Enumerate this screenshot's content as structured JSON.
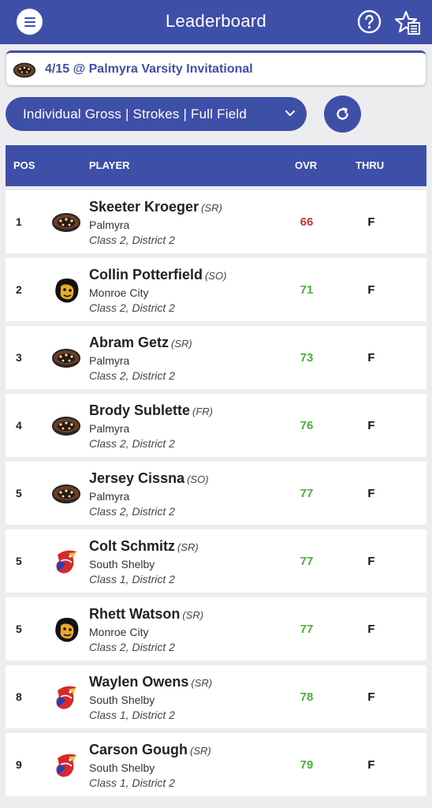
{
  "header": {
    "title": "Leaderboard"
  },
  "event": {
    "title": "4/15 @ Palmyra Varsity Invitational"
  },
  "view_select": {
    "label": "Individual Gross | Strokes | Full Field"
  },
  "table": {
    "columns": {
      "pos": "POS",
      "player": "PLAYER",
      "ovr": "OVR",
      "thru": "THRU"
    }
  },
  "colors": {
    "primary": "#3e4fa8",
    "score_under": "#c0392b",
    "score_over": "#4caf3a"
  },
  "rows": [
    {
      "pos": "1",
      "name": "Skeeter Kroeger",
      "year": "(SR)",
      "school": "Palmyra",
      "class": "Class 2, District 2",
      "score": "66",
      "thru": "F",
      "logo": "palmyra-logo-icon",
      "score_color": "#c0392b"
    },
    {
      "pos": "2",
      "name": "Collin Potterfield",
      "year": "(SO)",
      "school": "Monroe City",
      "class": "Class 2, District 2",
      "score": "71",
      "thru": "F",
      "logo": "monroe-city-logo-icon",
      "score_color": "#4caf3a"
    },
    {
      "pos": "3",
      "name": "Abram Getz",
      "year": "(SR)",
      "school": "Palmyra",
      "class": "Class 2, District 2",
      "score": "73",
      "thru": "F",
      "logo": "palmyra-logo-icon",
      "score_color": "#4caf3a"
    },
    {
      "pos": "4",
      "name": "Brody Sublette",
      "year": "(FR)",
      "school": "Palmyra",
      "class": "Class 2, District 2",
      "score": "76",
      "thru": "F",
      "logo": "palmyra-logo-icon",
      "score_color": "#4caf3a"
    },
    {
      "pos": "5",
      "name": "Jersey Cissna",
      "year": "(SO)",
      "school": "Palmyra",
      "class": "Class 2, District 2",
      "score": "77",
      "thru": "F",
      "logo": "palmyra-logo-icon",
      "score_color": "#4caf3a"
    },
    {
      "pos": "5",
      "name": "Colt Schmitz",
      "year": "(SR)",
      "school": "South Shelby",
      "class": "Class 1, District 2",
      "score": "77",
      "thru": "F",
      "logo": "south-shelby-logo-icon",
      "score_color": "#4caf3a"
    },
    {
      "pos": "5",
      "name": "Rhett Watson",
      "year": "(SR)",
      "school": "Monroe City",
      "class": "Class 2, District 2",
      "score": "77",
      "thru": "F",
      "logo": "monroe-city-logo-icon",
      "score_color": "#4caf3a"
    },
    {
      "pos": "8",
      "name": "Waylen Owens",
      "year": "(SR)",
      "school": "South Shelby",
      "class": "Class 1, District 2",
      "score": "78",
      "thru": "F",
      "logo": "south-shelby-logo-icon",
      "score_color": "#4caf3a"
    },
    {
      "pos": "9",
      "name": "Carson Gough",
      "year": "(SR)",
      "school": "South Shelby",
      "class": "Class 1, District 2",
      "score": "79",
      "thru": "F",
      "logo": "south-shelby-logo-icon",
      "score_color": "#4caf3a"
    }
  ]
}
